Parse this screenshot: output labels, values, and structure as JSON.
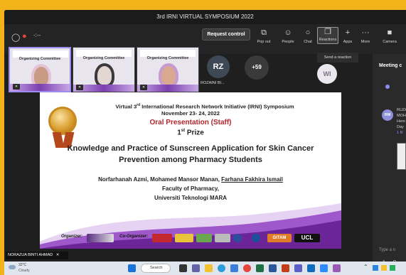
{
  "window": {
    "title": "3rd IRNI VIRTUAL SYMPOSIUM 2022"
  },
  "toolbar": {
    "request_control": "Request control",
    "tools": [
      {
        "label": "Pop out",
        "icon": "pop-out-icon"
      },
      {
        "label": "People",
        "icon": "people-icon"
      },
      {
        "label": "Chat",
        "icon": "chat-icon"
      },
      {
        "label": "Reactions",
        "icon": "reactions-icon"
      },
      {
        "label": "Apps",
        "icon": "apps-icon"
      },
      {
        "label": "More",
        "icon": "more-icon"
      },
      {
        "label": "Camera",
        "icon": "camera-icon"
      }
    ],
    "tooltip": "Send a reaction"
  },
  "participants": [
    {
      "initials": "RZ",
      "name": "ROZAINI BI..."
    },
    {
      "count": "+59"
    },
    {
      "initials": "WI"
    }
  ],
  "thumbnail_caption": "Organizing Committee",
  "side_panel": {
    "title": "Meeting c",
    "msg_avatar": "RM",
    "msg_lines": [
      "RUZA",
      "MOH",
      "Here",
      "Day",
      "1 fil"
    ],
    "type_placeholder": "Type a n"
  },
  "slide": {
    "line1_pre": "Virtual 3",
    "line1_sup": "rd",
    "line1_post": " International Research Network Initiative (IRNI) Symposium",
    "date": "November 23- 24, 2022",
    "category": "Oral Presentation (Staff)",
    "prize_num": "1",
    "prize_sup": "st",
    "prize_word": " Prize",
    "title1": "Knowledge and Practice of Sunscreen Application for Skin Cancer",
    "title2": "Prevention among Pharmacy Students",
    "authors_plain": "Norfarhanah Azmi, Mohamed Mansor Manan, ",
    "authors_underlined": "Farhana Fakhira Ismail",
    "faculty": "Faculty of Pharmacy,",
    "university": "Universiti Teknologi MARA",
    "organizer_label": "Organizer:",
    "coorganizer_label": "Co-Organizer:",
    "logo_texts": [
      "GITAM",
      "UCL"
    ]
  },
  "speaker_name": "NORAZUA BINTI AHMAD",
  "taskbar": {
    "weather_temp": "32°C",
    "weather_desc": "Cloudy",
    "search": "Search"
  }
}
